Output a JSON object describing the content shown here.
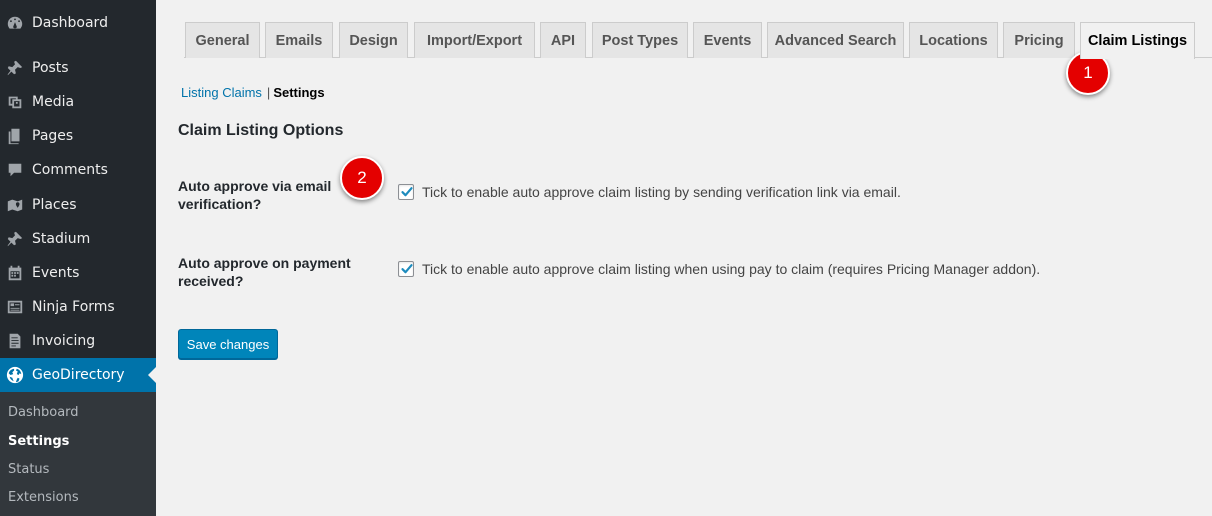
{
  "sidebar": {
    "items": [
      {
        "label": "Dashboard",
        "icon": "dashboard-icon"
      },
      {
        "label": "Posts",
        "icon": "pin-icon"
      },
      {
        "label": "Media",
        "icon": "media-icon"
      },
      {
        "label": "Pages",
        "icon": "pages-icon"
      },
      {
        "label": "Comments",
        "icon": "comment-icon"
      },
      {
        "label": "Places",
        "icon": "places-icon"
      },
      {
        "label": "Stadium",
        "icon": "pin-icon"
      },
      {
        "label": "Events",
        "icon": "calendar-icon"
      },
      {
        "label": "Ninja Forms",
        "icon": "forms-icon"
      },
      {
        "label": "Invoicing",
        "icon": "invoice-icon"
      },
      {
        "label": "GeoDirectory",
        "icon": "globe-icon"
      }
    ],
    "submenu": [
      "Dashboard",
      "Settings",
      "Status",
      "Extensions"
    ]
  },
  "tabs": [
    "General",
    "Emails",
    "Design",
    "Import/Export",
    "API",
    "Post Types",
    "Events",
    "Advanced Search",
    "Locations",
    "Pricing",
    "Claim Listings"
  ],
  "subnav": {
    "link": "Listing Claims",
    "separator": "|",
    "current": "Settings"
  },
  "section_title": "Claim Listing Options",
  "fields": [
    {
      "label": "Auto approve via email verification?",
      "description": "Tick to enable auto approve claim listing by sending verification link via email.",
      "checked": true
    },
    {
      "label": "Auto approve on payment received?",
      "description": "Tick to enable auto approve claim listing when using pay to claim (requires Pricing Manager addon).",
      "checked": true
    }
  ],
  "save_label": "Save changes",
  "markers": [
    "1",
    "2"
  ],
  "colors": {
    "sidebar_bg": "#23282d",
    "active_menu": "#0073aa",
    "button": "#0085ba",
    "marker": "#e40000"
  }
}
